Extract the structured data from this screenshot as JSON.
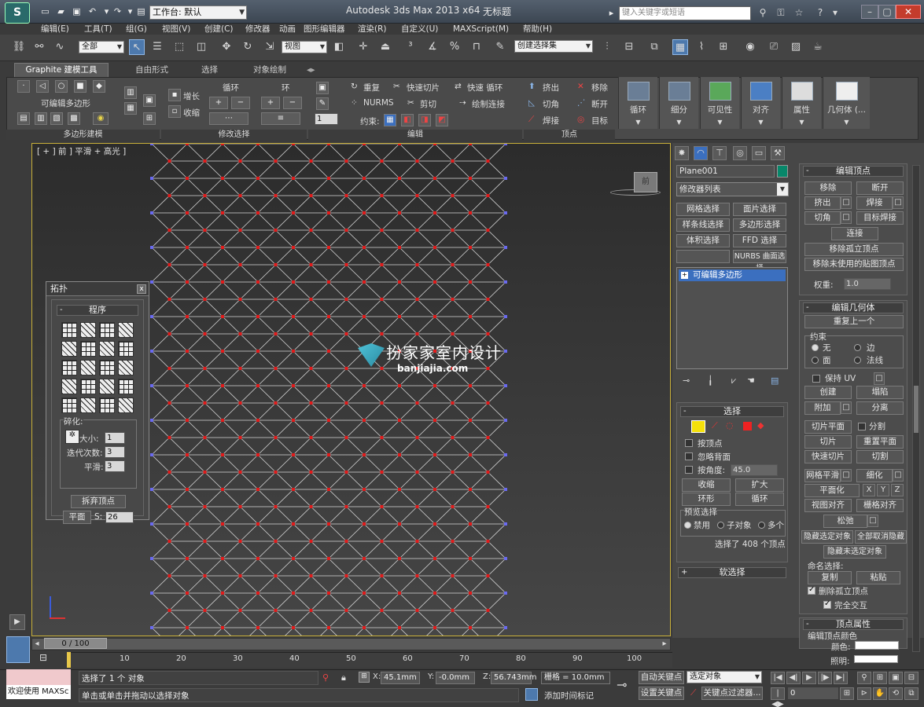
{
  "titlebar": {
    "workspace": "工作台: 默认",
    "app_title": "Autodesk 3ds Max  2013 x64",
    "doc_title": "无标题",
    "search_placeholder": "键入关键字或短语"
  },
  "menu": [
    "编辑(E)",
    "工具(T)",
    "组(G)",
    "视图(V)",
    "创建(C)",
    "修改器",
    "动画",
    "图形编辑器",
    "渲染(R)",
    "自定义(U)",
    "MAXScript(M)",
    "帮助(H)"
  ],
  "toolbar": {
    "selection_filter": "全部",
    "ref_coord": "视图",
    "named_selection": "创建选择集"
  },
  "ribbon": {
    "tabs": [
      "Graphite 建模工具",
      "自由形式",
      "选择",
      "对象绘制"
    ],
    "poly_label": "可编辑多边形",
    "grow": "增长",
    "shrink": "收缩",
    "loop": "循环",
    "ring": "环",
    "repeat": "重复",
    "quickslice": "快速切片",
    "quickloop": "快速 循环",
    "nurms": "NURMS",
    "cut": "剪切",
    "paintconnect": "绘制连接",
    "constraint": "约束:",
    "extrude": "挤出",
    "remove": "移除",
    "chamfer": "切角",
    "break": "断开",
    "weld": "焊接",
    "target": "目标",
    "spinner_val": "1",
    "footers": [
      "多边形建模",
      "修改选择",
      "编辑",
      "顶点"
    ],
    "big_buttons": [
      "循环",
      "细分",
      "可见性",
      "对齐",
      "属性",
      "几何体 (..."
    ]
  },
  "viewport": {
    "label": "[ + ] 前 ] 平滑 + 高光 ]",
    "viewcube_label": "前",
    "watermark_text": "扮家家室内设计",
    "watermark_url": "banjiajia.com"
  },
  "topology": {
    "title": "拓扑",
    "section": "程序",
    "fragment": "碎化:",
    "size_label": "大小:",
    "size_val": "1",
    "iter_label": "迭代次数:",
    "iter_val": "3",
    "smooth_label": "平滑:",
    "smooth_val": "3",
    "discard_btn": "拆弃顶点",
    "plane_btn": "平面",
    "s_label": "S:",
    "s_val": "26"
  },
  "cmdpanel": {
    "object_name": "Plane001",
    "object_color": "#07876a",
    "modifier_list": "修改器列表",
    "mod_buttons": [
      "网格选择",
      "面片选择",
      "样条线选择",
      "多边形选择",
      "体积选择",
      "FFD 选择",
      "NURBS 曲面选择"
    ],
    "stack_item": "可编辑多边形",
    "selection": {
      "title": "选择",
      "by_vertex": "按顶点",
      "ignore_back": "忽略背面",
      "by_angle": "按角度:",
      "angle_val": "45.0",
      "shrink": "收缩",
      "grow": "扩大",
      "ring": "环形",
      "loop": "循环",
      "preview": "预览选择",
      "disabled": "禁用",
      "subobj": "子对象",
      "multi": "多个",
      "status": "选择了 408 个顶点"
    },
    "soft_selection": "软选择"
  },
  "editvert": {
    "title": "编辑顶点",
    "remove": "移除",
    "break": "断开",
    "extrude": "挤出",
    "weld": "焊接",
    "chamfer": "切角",
    "target_weld": "目标焊接",
    "connect": "连接",
    "remove_iso": "移除孤立顶点",
    "remove_unused": "移除未使用的贴图顶点",
    "weight": "权重:",
    "weight_val": "1.0"
  },
  "editgeom": {
    "title": "编辑几何体",
    "repeat_last": "重复上一个",
    "constraint": "约束",
    "none": "无",
    "edge": "边",
    "face": "面",
    "normal": "法线",
    "preserve_uv": "保持 UV",
    "create": "创建",
    "collapse": "塌陷",
    "attach": "附加",
    "detach": "分离",
    "slice_plane": "切片平面",
    "split": "分割",
    "slice": "切片",
    "reset_plane": "重置平面",
    "quickslice": "快速切片",
    "cut": "切割",
    "meshsmooth": "网格平滑",
    "tessellate": "细化",
    "planarize": "平面化",
    "x": "X",
    "y": "Y",
    "z": "Z",
    "view_align": "视图对齐",
    "grid_align": "栅格对齐",
    "relax": "松弛",
    "hide_sel": "隐藏选定对象",
    "unhide_all": "全部取消隐藏",
    "hide_unsel": "隐藏未选定对象",
    "named_sel": "命名选择:",
    "copy": "复制",
    "paste": "粘贴",
    "delete_iso": "删除孤立顶点",
    "full_interact": "完全交互"
  },
  "vertprops": {
    "title": "顶点属性",
    "sub": "编辑顶点颜色",
    "color": "颜色:",
    "illum": "照明:"
  },
  "timeline": {
    "frame": "0 / 100",
    "ticks": [
      "10",
      "20",
      "30",
      "40",
      "50",
      "60",
      "70",
      "80",
      "90",
      "100"
    ]
  },
  "status": {
    "welcome": "欢迎使用 MAXSc",
    "line1": "选择了 1 个 对象",
    "line2": "单击或单击并拖动以选择对象",
    "x_label": "X:",
    "x_val": "45.1mm",
    "y_label": "Y:",
    "y_val": "-0.0mm",
    "z_label": "Z:",
    "z_val": "56.743mm",
    "grid": "栅格 = 10.0mm",
    "autokey": "自动关键点",
    "selected": "选定对象",
    "setkey": "设置关键点",
    "keyfilter": "关键点过滤器...",
    "addtime": "添加时间标记",
    "frame_val": "0"
  }
}
